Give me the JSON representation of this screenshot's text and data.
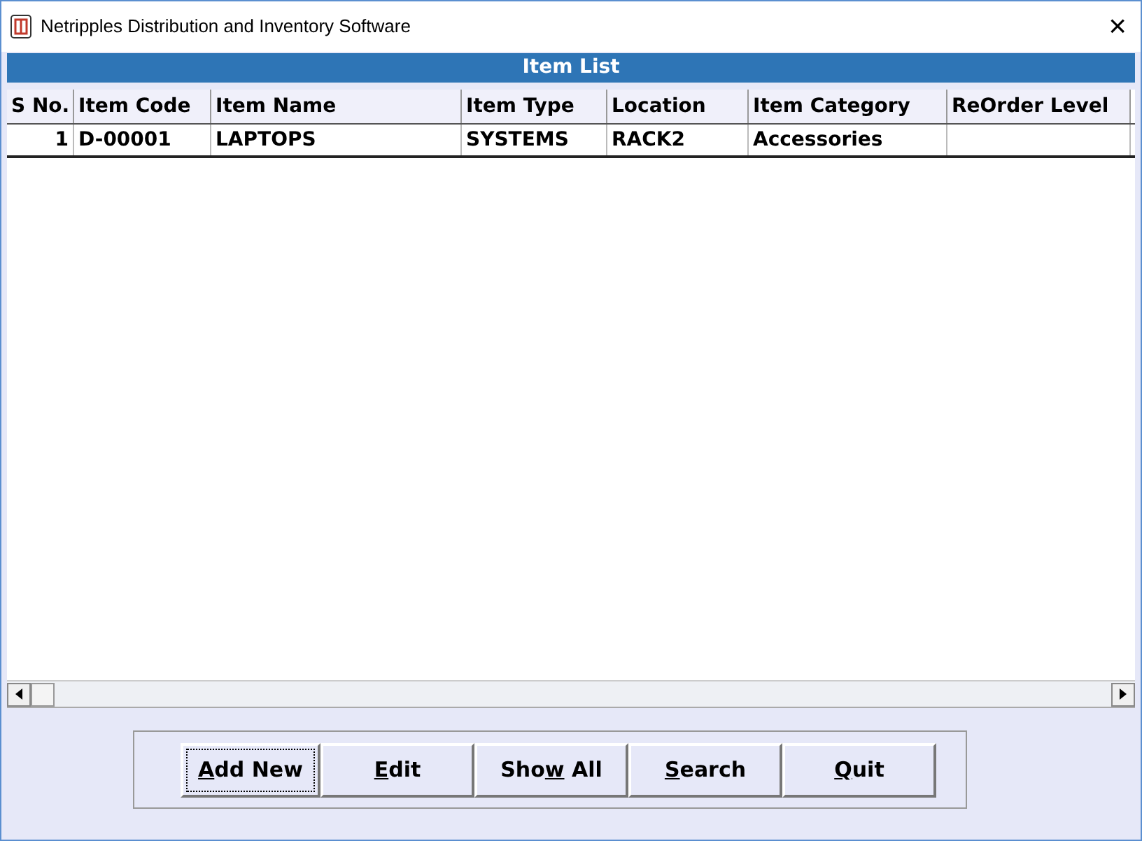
{
  "window": {
    "title": "Netripples Distribution and Inventory Software",
    "close": "×"
  },
  "panel_title": "Item List",
  "table": {
    "columns": [
      "S No.",
      "Item Code",
      "Item Name",
      "Item  Type",
      "Location",
      "Item Category",
      "ReOrder Level"
    ],
    "rows": [
      [
        "1",
        "D-00001",
        "LAPTOPS",
        "SYSTEMS",
        "RACK2",
        "Accessories",
        ""
      ]
    ]
  },
  "buttons": [
    {
      "segments": [
        {
          "text": "A",
          "underlined": true
        },
        {
          "text": "dd New",
          "underlined": false
        }
      ],
      "focused": true
    },
    {
      "segments": [
        {
          "text": "E",
          "underlined": true
        },
        {
          "text": "dit",
          "underlined": false
        }
      ],
      "focused": false
    },
    {
      "segments": [
        {
          "text": "Sho",
          "underlined": false
        },
        {
          "text": "w",
          "underlined": true
        },
        {
          "text": " All",
          "underlined": false
        }
      ],
      "focused": false
    },
    {
      "segments": [
        {
          "text": "S",
          "underlined": true
        },
        {
          "text": "earch",
          "underlined": false
        }
      ],
      "focused": false
    },
    {
      "segments": [
        {
          "text": "Q",
          "underlined": true
        },
        {
          "text": "uit",
          "underlined": false
        }
      ],
      "focused": false
    }
  ]
}
